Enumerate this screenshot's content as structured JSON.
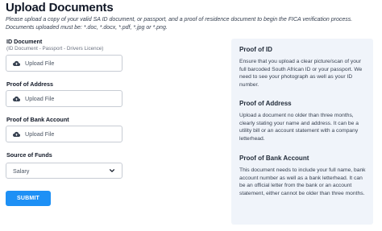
{
  "page": {
    "title": "Upload Documents",
    "intro": "Please upload a copy of your valid SA ID document, or passport, and a proof of residence document to begin the FICA verification process. Documents uploaded must be: *.doc, *.docx, *.pdf, *.jpg or *.png."
  },
  "form": {
    "id_document": {
      "label": "ID Document",
      "sublabel": "(ID Document - Passport - Drivers Licence)",
      "button": "Upload File",
      "icon": "cloud-upload-icon"
    },
    "proof_of_address": {
      "label": "Proof of Address",
      "button": "Upload File",
      "icon": "cloud-upload-icon"
    },
    "proof_of_bank_account": {
      "label": "Proof of Bank Account",
      "button": "Upload File",
      "icon": "cloud-upload-icon"
    },
    "source_of_funds": {
      "label": "Source of Funds",
      "selected": "Salary",
      "icon": "chevron-down-icon"
    },
    "submit_label": "SUBMIT"
  },
  "info": {
    "sections": [
      {
        "title": "Proof of ID",
        "body": "Ensure that you upload a clear picture/scan of your full barcoded South African ID or your passport. We need to see your photograph as well as your ID number."
      },
      {
        "title": "Proof of Address",
        "body": "Upload a document no older than three months, clearly stating your name and address. It can be a utility bill or an account statement with a company letterhead."
      },
      {
        "title": "Proof of Bank Account",
        "body": "This document needs to include your full name, bank account number as well as a bank letterhead. It can be an official letter from the bank or an account statement, either cannot be older than three months."
      }
    ]
  },
  "colors": {
    "accent": "#1e90f5",
    "panel_bg": "#f0f4fa"
  }
}
